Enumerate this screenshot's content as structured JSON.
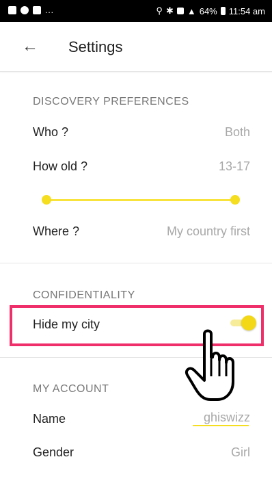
{
  "status_bar": {
    "notifications": "...",
    "battery": "64%",
    "time": "11:54 am"
  },
  "app_bar": {
    "back_icon": "back-arrow-icon",
    "title": "Settings"
  },
  "discovery": {
    "section_title": "DISCOVERY PREFERENCES",
    "who_label": "Who ?",
    "who_value": "Both",
    "age_label": "How old ?",
    "age_value": "13-17",
    "where_label": "Where ?",
    "where_value": "My country first",
    "accent_color": "#f5dd1f"
  },
  "confidentiality": {
    "section_title": "CONFIDENTIALITY",
    "hide_city_label": "Hide my city",
    "hide_city_enabled": true,
    "highlight_color": "#ef2f6a"
  },
  "account": {
    "section_title": "MY ACCOUNT",
    "name_label": "Name",
    "name_value": "ghiswizz",
    "gender_label": "Gender",
    "gender_value": "Girl"
  }
}
